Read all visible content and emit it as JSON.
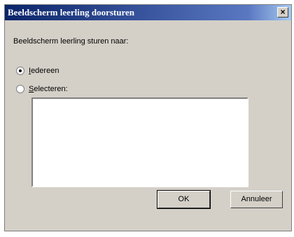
{
  "dialog": {
    "title": "Beeldscherm leerling doorsturen",
    "close_label": "×",
    "prompt": "Beeldscherm leerling sturen naar:",
    "options": [
      {
        "label": "Iedereen",
        "checked": true
      },
      {
        "label": "Selecteren:",
        "checked": false
      }
    ],
    "ok_label": "OK",
    "cancel_label": "Annuleer"
  }
}
